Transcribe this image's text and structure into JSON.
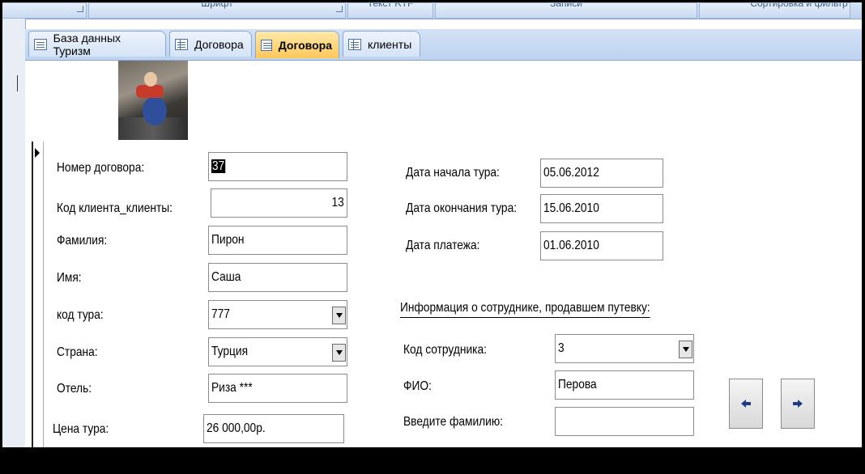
{
  "ribbon": {
    "groups": [
      "",
      "Шрифт",
      "Текст RTF",
      "Записи",
      "Сортировка и фильтр"
    ]
  },
  "tabs": [
    {
      "label": "База данных Туризм",
      "icon": "form-icon",
      "active": false
    },
    {
      "label": "Договора",
      "icon": "table-icon",
      "active": false
    },
    {
      "label": "Договора",
      "icon": "form-icon",
      "active": true
    },
    {
      "label": "клиенты",
      "icon": "table-icon",
      "active": false
    }
  ],
  "form": {
    "contract_number_label": "Номер договора:",
    "contract_number_value": "37",
    "client_code_label": "Код клиента_клиенты:",
    "client_code_value": "13",
    "surname_label": "Фамилия:",
    "surname_value": "Пирон",
    "name_label": "Имя:",
    "name_value": "Саша",
    "tour_code_label": "код тура:",
    "tour_code_value": "777",
    "country_label": "Страна:",
    "country_value": "Турция",
    "hotel_label": "Отель:",
    "hotel_value": "Риза ***",
    "price_label": "Цена тура:",
    "price_value": "26 000,00р.",
    "tour_start_label": "Дата начала тура:",
    "tour_start_value": "05.06.2012",
    "tour_end_label": "Дата окончания тура:",
    "tour_end_value": "15.06.2010",
    "payment_date_label": "Дата платежа:",
    "payment_date_value": "01.06.2010",
    "employee_section_title": "Информация о сотруднике, продавшем путевку:",
    "employee_code_label": "Код сотрудника:",
    "employee_code_value": "3",
    "employee_name_label": "ФИО:",
    "employee_name_value": "Перова",
    "enter_surname_label": "Введите фамилию:",
    "enter_surname_value": ""
  },
  "icons": {
    "prev": "arrow-left-icon",
    "next": "arrow-right-icon",
    "record": "record-selector-arrow-icon"
  },
  "colors": {
    "active_tab": "#ffc85a",
    "tab_bar": "#bdd3ef",
    "nav_arrow": "#1f3c88"
  }
}
